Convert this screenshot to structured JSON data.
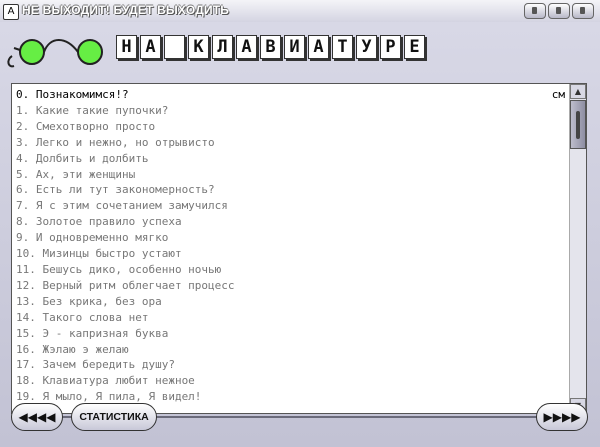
{
  "window": {
    "icon": "А",
    "title": "НЕ ВЫХОДИТ! БУДЕТ ВЫХОДИТЬ"
  },
  "header": {
    "logo_letters": [
      "Н",
      "А",
      "",
      "К",
      "Л",
      "А",
      "В",
      "И",
      "А",
      "Т",
      "У",
      "Р",
      "Е"
    ]
  },
  "lessons": {
    "selected_index": 0,
    "selected_tag": "см",
    "items": [
      "0. Познакомимся!?",
      "1. Какие такие пупочки?",
      "2. Смехотворно просто",
      "3. Легко и нежно, но отрывисто",
      "4. Долбить и долбить",
      "5. Ах, эти женщины",
      "6. Есть ли тут закономерность?",
      "7. Я с этим сочетанием замучился",
      "8. Золотое правило успеха",
      "9. И одновременно мягко",
      "10. Мизинцы быстро устают",
      "11. Бешусь дико, особенно ночью",
      "12. Верный ритм облегчает процесс",
      "13. Без крика, без ора",
      "14. Такого слова нет",
      "15. Э - капризная буква",
      "16. Жэлаю э желаю",
      "17. Зачем бередить душу?",
      "18. Клавиатура любит нежное",
      "19. Я мыло, Я пила, Я видел!"
    ]
  },
  "footer": {
    "prev_label": "◀◀◀◀",
    "next_label": "▶▶▶▶",
    "stats_label": "СТАТИСТИКА"
  },
  "scrollbar": {
    "up_icon": "▲",
    "down_icon": "▼"
  }
}
